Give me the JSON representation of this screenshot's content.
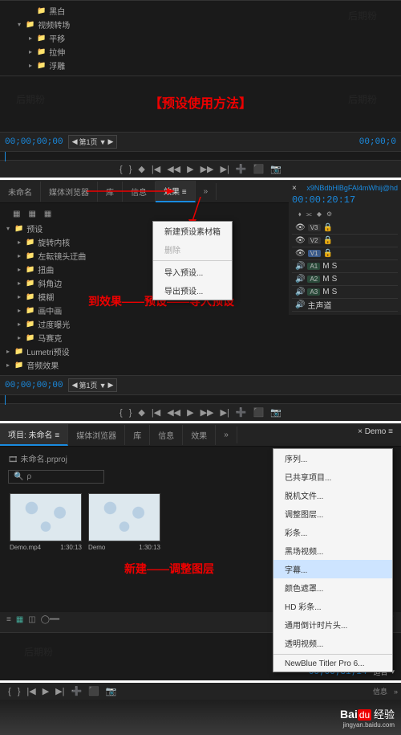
{
  "tree_top": [
    {
      "label": "黑白",
      "indent": 2,
      "expandable": false
    },
    {
      "label": "视频转场",
      "indent": 1,
      "expandable": true
    },
    {
      "label": "平移",
      "indent": 2,
      "expandable": false
    },
    {
      "label": "拉伸",
      "indent": 2,
      "expandable": false
    },
    {
      "label": "浮雕",
      "indent": 2,
      "expandable": false
    }
  ],
  "title1": "【预设使用方法】",
  "timecode1": "00;00;00;00",
  "page_label": "第1页",
  "timecode_right1": "00;00;0",
  "tabs_mid": {
    "proj": "未命名",
    "browser": "媒体浏览器",
    "lib": "库",
    "info": "信息",
    "fx": "效果"
  },
  "seq": {
    "name": "x9NBdbHlBgFAl4mWhij@hd",
    "tc": "00:00:20:17"
  },
  "tree_fx": [
    {
      "label": "预设",
      "indent": 0
    },
    {
      "label": "旋转内核",
      "indent": 1
    },
    {
      "label": "左転镜头迂曲",
      "indent": 1
    },
    {
      "label": "扭曲",
      "indent": 1
    },
    {
      "label": "斜角边",
      "indent": 1
    },
    {
      "label": "模糊",
      "indent": 1
    },
    {
      "label": "画中画",
      "indent": 1
    },
    {
      "label": "过度曝光",
      "indent": 1
    },
    {
      "label": "马赛克",
      "indent": 1
    },
    {
      "label": "Lumetri预设",
      "indent": 0
    },
    {
      "label": "音频效果",
      "indent": 0
    }
  ],
  "ctx1": [
    "新建预设素材箱",
    "删除",
    "导入预设...",
    "导出预设..."
  ],
  "red_text1": "到效果——预设——导入预设",
  "tracks": {
    "v": [
      "V3",
      "V2",
      "V1"
    ],
    "a": [
      "A1",
      "A2",
      "A3"
    ],
    "master": "主声道"
  },
  "timecode2": "00;00;00;00",
  "proj_tabs": {
    "proj": "项目: 未命名",
    "browser": "媒体浏览器",
    "lib": "库",
    "info": "信息",
    "fx": "效果"
  },
  "demo_tab": "Demo",
  "proj_file": "未命名.prproj",
  "search_placeholder": "ρ",
  "red_text2": "新建——调整图层",
  "thumbs": [
    {
      "name": "Demo.mp4",
      "dur": "1:30:13"
    },
    {
      "name": "Demo",
      "dur": "1:30:13"
    }
  ],
  "ctx2": [
    "序列...",
    "已共享项目...",
    "脱机文件...",
    "调整图层...",
    "彩条...",
    "黑场视频...",
    "字幕...",
    "颜色遮罩...",
    "HD 彩条...",
    "通用倒计时片头...",
    "透明视频...",
    "NewBlue Titler Pro 6..."
  ],
  "ctx2_highlight": "字幕...",
  "timecode3": "00;00;31;14",
  "fit_label": "适合",
  "footer": {
    "brand": "Bai",
    "du": "du",
    "exp": "经验",
    "url": "jingyan.baidu.com"
  },
  "wm": "后期粉"
}
